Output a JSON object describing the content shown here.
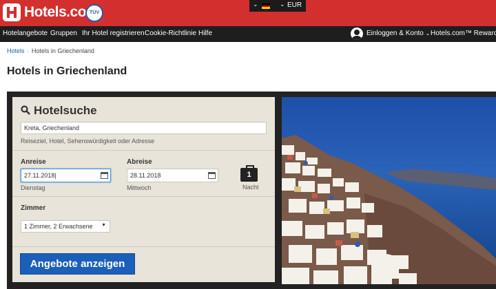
{
  "brand": {
    "name": "Hotels.com",
    "tm": "TM",
    "badge": "TÜV"
  },
  "locale": {
    "currency": "EUR",
    "flag_colors": [
      "#000000",
      "#dd0000",
      "#ffce00"
    ]
  },
  "nav": {
    "items": [
      "Hotelangebote",
      "Gruppen",
      "Ihr Hotel registrieren",
      "Cookie-Richtlinie",
      "Hilfe"
    ],
    "login_label": "Einloggen & Konto",
    "rewards_label": "Hotels.com™ Rewards"
  },
  "breadcrumb": {
    "home": "Hotels",
    "current": "Hotels in Griechenland"
  },
  "page": {
    "title": "Hotels in Griechenland"
  },
  "search": {
    "title": "Hotelsuche",
    "destination_value": "Kreta, Griechenland",
    "destination_hint": "Reiseziel, Hotel, Sehenswürdigkeit oder Adresse",
    "checkin_label": "Anreise",
    "checkin_value": "27.11.2018",
    "checkin_weekday": "Dienstag",
    "checkout_label": "Abreise",
    "checkout_value": "28.11.2018",
    "checkout_weekday": "Mittwoch",
    "nights_count": "1",
    "nights_label": "Nacht",
    "rooms_label": "Zimmer",
    "rooms_value": "1 Zimmer, 2 Erwachsene",
    "submit_label": "Angebote anzeigen"
  },
  "colors": {
    "brand_red": "#d32f2f",
    "nav_dark": "#1e1e1e",
    "button_blue": "#1b5fb8",
    "panel_bg": "#e8e4da"
  }
}
